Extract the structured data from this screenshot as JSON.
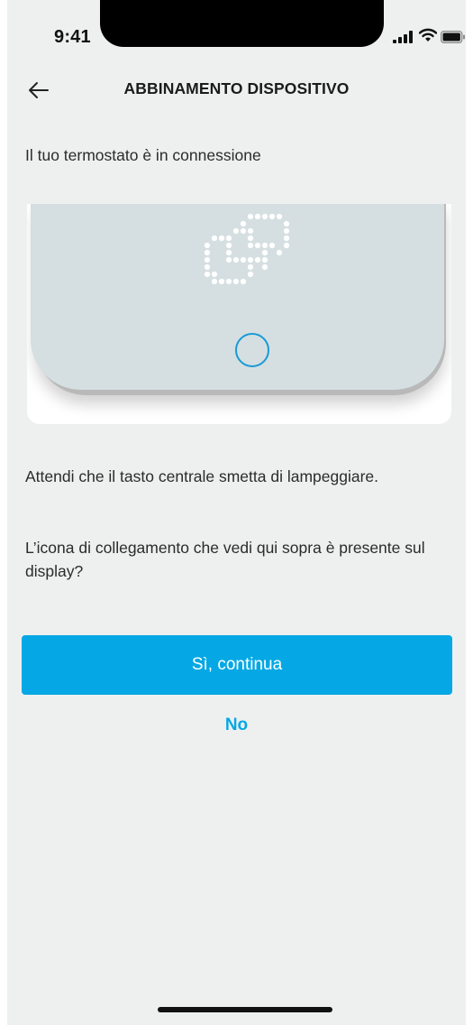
{
  "status_bar": {
    "time": "9:41"
  },
  "header": {
    "title": "ABBINAMENTO DISPOSITIVO"
  },
  "subtitle": "Il tuo termostato è in connessione",
  "instructions": [
    "Attendi che il tasto centrale smetta di lampeggiare.",
    "L’icona di collegamento che vedi qui sopra è presente sul display?"
  ],
  "actions": {
    "primary": "Sì, continua",
    "secondary": "No"
  },
  "icons": {
    "back": "back-arrow-icon",
    "link": "link-icon",
    "signal": "cellular-signal-icon",
    "wifi": "wifi-icon",
    "battery": "battery-icon"
  },
  "colors": {
    "accent": "#05a8e4",
    "background": "#eef0ef",
    "device_face": "#d5dfe1",
    "ring": "#1a9ad6"
  }
}
